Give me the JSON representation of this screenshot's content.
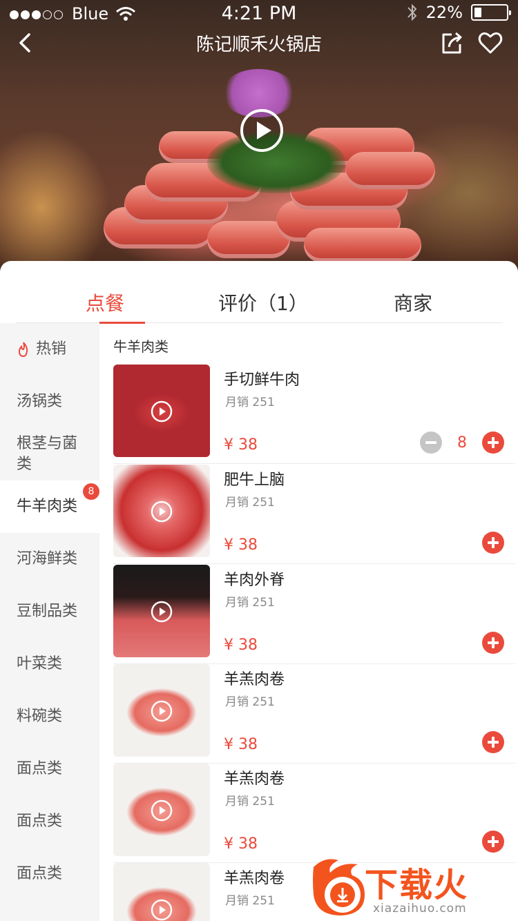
{
  "status_bar": {
    "carrier": "Blue",
    "time": "4:21 PM",
    "battery": "22%",
    "battery_level": 0.22
  },
  "nav": {
    "title": "陈记顺禾火锅店"
  },
  "tabs": [
    {
      "label": "点餐",
      "active": true
    },
    {
      "label": "评价（1）",
      "active": false
    },
    {
      "label": "商家",
      "active": false
    }
  ],
  "sidebar": {
    "items": [
      {
        "label": "热销",
        "icon": "fire-icon"
      },
      {
        "label": "汤锅类"
      },
      {
        "label": "根茎与菌类"
      },
      {
        "label": "牛羊肉类",
        "badge": "8",
        "active": true
      },
      {
        "label": "河海鲜类"
      },
      {
        "label": "豆制品类"
      },
      {
        "label": "叶菜类"
      },
      {
        "label": "料碗类"
      },
      {
        "label": "面点类"
      },
      {
        "label": "面点类"
      },
      {
        "label": "面点类"
      }
    ]
  },
  "section": {
    "title": "牛羊肉类"
  },
  "dishes": [
    {
      "name": "手切鲜牛肉",
      "sales": "月销 251",
      "price": "¥ 38",
      "qty": "8"
    },
    {
      "name": "肥牛上脑",
      "sales": "月销 251",
      "price": "¥ 38"
    },
    {
      "name": "羊肉外脊",
      "sales": "月销 251",
      "price": "¥ 38"
    },
    {
      "name": "羊羔肉卷",
      "sales": "月销 251",
      "price": "¥ 38"
    },
    {
      "name": "羊羔肉卷",
      "sales": "月销 251",
      "price": "¥ 38"
    },
    {
      "name": "羊羔肉卷",
      "sales": "月销 251"
    }
  ],
  "watermark": {
    "brand": "下载火",
    "url": "xiazaihuo.com"
  },
  "colors": {
    "accent": "#ea4a3c",
    "sidebar_bg": "#f5f5f5",
    "watermark": "#f3541e"
  }
}
